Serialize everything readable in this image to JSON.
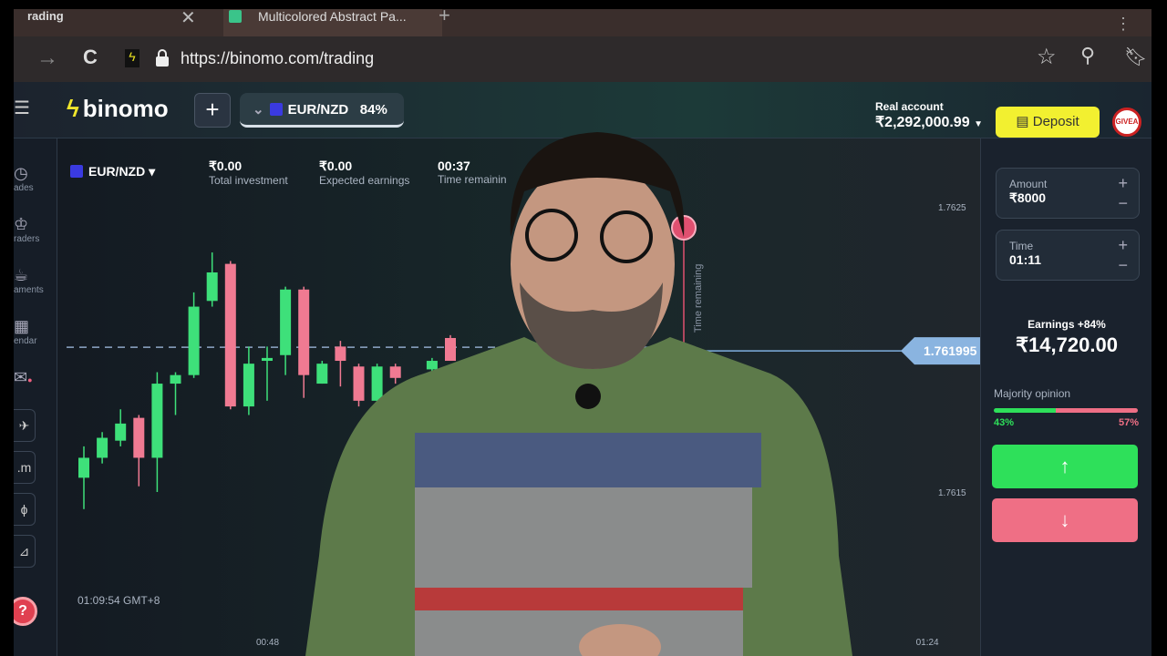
{
  "browser": {
    "active_tab": "rading",
    "tab2_title": "Multicolored Abstract Pa...",
    "url": "https://binomo.com/trading"
  },
  "header": {
    "logo": "binomo",
    "asset": "EUR/NZD",
    "payout": "84%",
    "account_label": "Real account",
    "balance": "₹2,292,000.99",
    "deposit": "Deposit",
    "avatar_text": "GIVEA"
  },
  "sidebar": {
    "items": [
      {
        "icon": "clock-icon",
        "label": "ades"
      },
      {
        "icon": "trophy-icon",
        "label": "raders"
      },
      {
        "icon": "cup-icon",
        "label": "aments"
      },
      {
        "icon": "calendar-icon",
        "label": "endar"
      },
      {
        "icon": "gift-icon",
        "label": ""
      }
    ],
    "buttons": [
      "rocket-icon",
      ".m",
      "indicator-icon",
      "drawing-icon"
    ],
    "help": "?"
  },
  "chart_info": {
    "asset": "EUR/NZD",
    "total_investment": "₹0.00",
    "total_investment_label": "Total investment",
    "expected_earnings": "₹0.00",
    "expected_earnings_label": "Expected earnings",
    "time_remaining": "00:37",
    "time_remaining_label": "Time remainin",
    "time_remaining_vertical": "Time remaining",
    "timestamp": "01:09:54 GMT+8"
  },
  "chart_data": {
    "type": "candlestick",
    "y_ticks": [
      "1.7625",
      "1.7615"
    ],
    "ylim": [
      1.7614,
      1.7625
    ],
    "x_ticks": [
      "00:48",
      "01:24"
    ],
    "current_price": "1.761995",
    "price_value": 1.761995,
    "candles": [
      {
        "t": 38,
        "o": 1.76155,
        "h": 1.76166,
        "l": 1.76144,
        "c": 1.76162
      },
      {
        "t": 39,
        "o": 1.76162,
        "h": 1.76171,
        "l": 1.7616,
        "c": 1.76169
      },
      {
        "t": 40,
        "o": 1.76168,
        "h": 1.76179,
        "l": 1.76166,
        "c": 1.76174
      },
      {
        "t": 41,
        "o": 1.76176,
        "h": 1.76177,
        "l": 1.76152,
        "c": 1.76162
      },
      {
        "t": 42,
        "o": 1.76162,
        "h": 1.76192,
        "l": 1.7615,
        "c": 1.76188
      },
      {
        "t": 43,
        "o": 1.76188,
        "h": 1.76192,
        "l": 1.76177,
        "c": 1.76191
      },
      {
        "t": 44,
        "o": 1.76191,
        "h": 1.7622,
        "l": 1.7619,
        "c": 1.76215
      },
      {
        "t": 45,
        "o": 1.76217,
        "h": 1.76234,
        "l": 1.76215,
        "c": 1.76227
      },
      {
        "t": 46,
        "o": 1.7623,
        "h": 1.76231,
        "l": 1.76179,
        "c": 1.7618
      },
      {
        "t": 47,
        "o": 1.7618,
        "h": 1.76201,
        "l": 1.76177,
        "c": 1.76195
      },
      {
        "t": 48,
        "o": 1.76196,
        "h": 1.76201,
        "l": 1.76182,
        "c": 1.76197
      },
      {
        "t": 49,
        "o": 1.76198,
        "h": 1.76222,
        "l": 1.76191,
        "c": 1.76221
      },
      {
        "t": 50,
        "o": 1.76221,
        "h": 1.76222,
        "l": 1.76183,
        "c": 1.76191
      },
      {
        "t": 51,
        "o": 1.76188,
        "h": 1.76196,
        "l": 1.76188,
        "c": 1.76195
      },
      {
        "t": 52,
        "o": 1.76201,
        "h": 1.76203,
        "l": 1.76187,
        "c": 1.76196
      },
      {
        "t": 53,
        "o": 1.76194,
        "h": 1.76195,
        "l": 1.7618,
        "c": 1.76182
      },
      {
        "t": 54,
        "o": 1.76182,
        "h": 1.76195,
        "l": 1.7618,
        "c": 1.76194
      },
      {
        "t": 55,
        "o": 1.76194,
        "h": 1.76195,
        "l": 1.76188,
        "c": 1.7619
      },
      {
        "t": 57,
        "o": 1.76193,
        "h": 1.76197,
        "l": 1.76192,
        "c": 1.76196
      },
      {
        "t": 58,
        "o": 1.76204,
        "h": 1.76205,
        "l": 1.76196,
        "c": 1.76196
      }
    ],
    "colors": {
      "up": "#3ee07a",
      "down": "#f07a92"
    }
  },
  "panel": {
    "amount_label": "Amount",
    "amount": "₹8000",
    "time_label": "Time",
    "time": "01:11",
    "earnings_label": "Earnings +84%",
    "earnings": "₹14,720.00",
    "majority_label": "Majority opinion",
    "up_pct": "43%",
    "down_pct": "57%",
    "up_value": 43,
    "up_arrow": "↑",
    "down_arrow": "↓"
  },
  "colors": {
    "accent_yellow": "#f2f030",
    "up": "#2ee05a",
    "down": "#ef6f85"
  }
}
